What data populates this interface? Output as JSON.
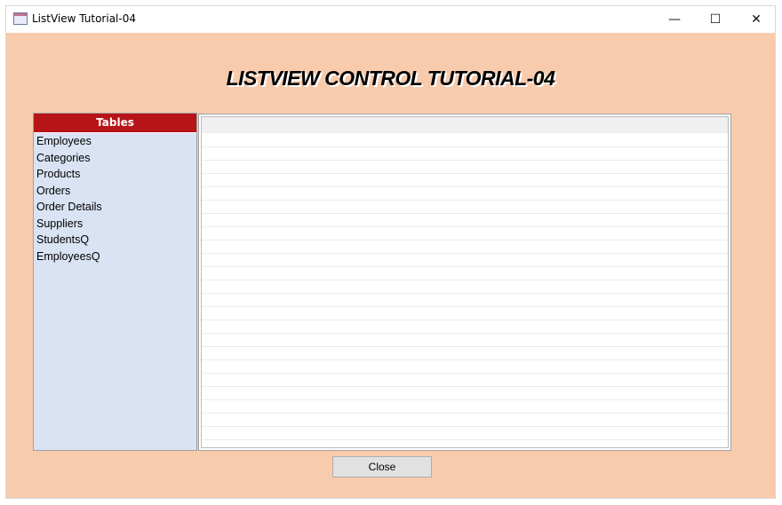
{
  "window": {
    "title": "ListView Tutorial-04",
    "minimize": "—",
    "maximize": "☐",
    "close": "✕"
  },
  "heading": "LISTVIEW CONTROL TUTORIAL-04",
  "tables": {
    "header": "Tables",
    "items": [
      "Employees",
      "Categories",
      "Products",
      "Orders",
      "Order Details",
      "Suppliers",
      "StudentsQ",
      "EmployeesQ"
    ]
  },
  "close_button": "Close",
  "colors": {
    "background": "#F8CBAD",
    "header": "#B71418",
    "list": "#DAE3F3"
  }
}
